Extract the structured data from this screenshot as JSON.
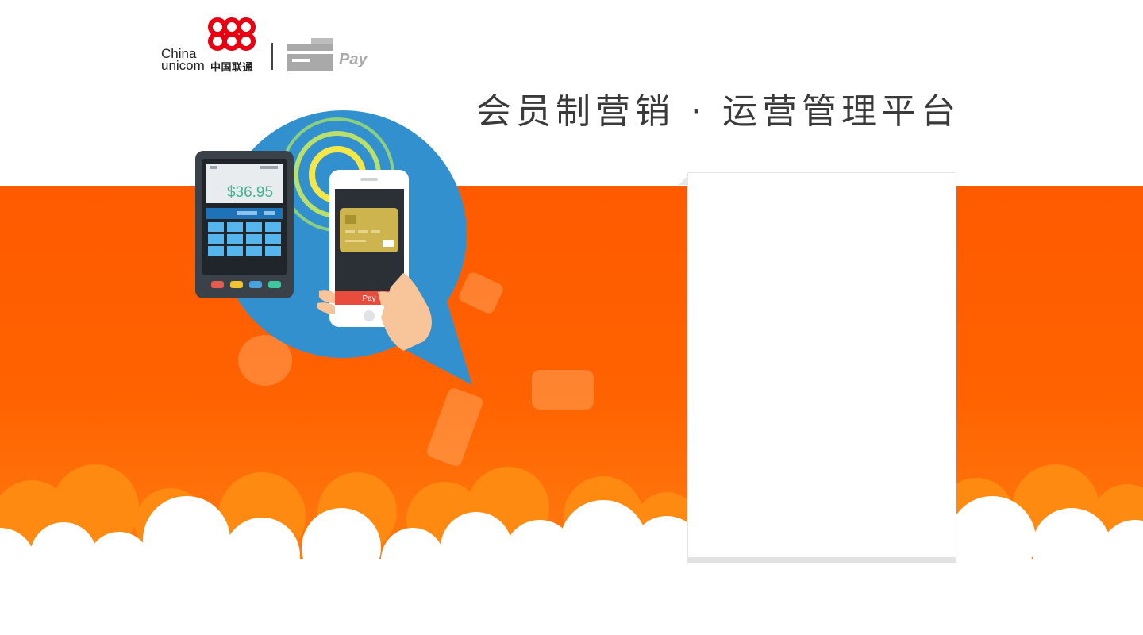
{
  "header": {
    "brand_china": "China",
    "brand_unicom": "unicom",
    "brand_cn": "中国联通",
    "pay_label": "Pay",
    "title": "会员制营销 · 运营管理平台"
  },
  "illustration": {
    "terminal_amount": "$36.95",
    "phone_pay_label": "Pay"
  },
  "colors": {
    "brand_orange": "#ff5a00",
    "bubble_blue": "#3390cf",
    "logo_red": "#e60012"
  }
}
